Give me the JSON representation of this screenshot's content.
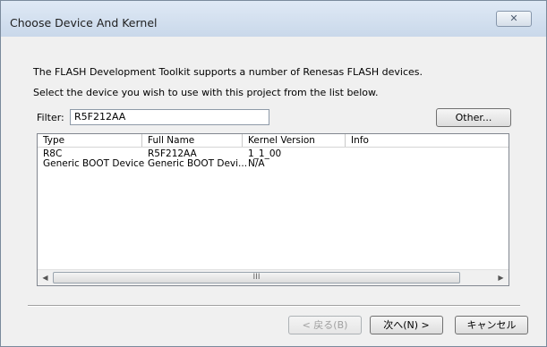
{
  "window": {
    "title": "Choose Device And Kernel",
    "close_icon": "✕"
  },
  "intro": {
    "line1": "The FLASH Development Toolkit supports a number of Renesas FLASH devices.",
    "line2": "Select the device you wish to use with this project from the list below."
  },
  "filter": {
    "label": "Filter:",
    "value": "R5F212AA"
  },
  "other_button": "Other...",
  "list": {
    "columns": [
      "Type",
      "Full Name",
      "Kernel Version",
      "Info"
    ],
    "rows": [
      {
        "type": "R8C",
        "full_name": "R5F212AA",
        "kernel_version": "1_1_00",
        "info": ""
      },
      {
        "type": "Generic BOOT Device",
        "full_name": "Generic BOOT Devi...",
        "kernel_version": "N/A",
        "info": ""
      }
    ],
    "scroll": {
      "left_icon": "left-arrow-icon",
      "right_icon": "right-arrow-icon",
      "thumb_grip": "III"
    }
  },
  "buttons": {
    "back": "< 戻る(B)",
    "next": "次へ(N) >",
    "cancel": "キャンセル"
  }
}
